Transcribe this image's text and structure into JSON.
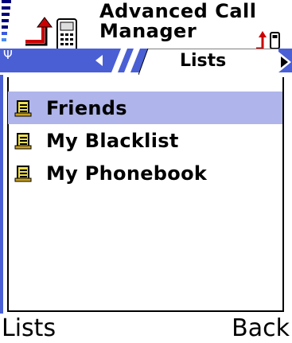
{
  "app": {
    "title_line1": "Advanced Call",
    "title_line2": "Manager"
  },
  "status": {
    "signal_icon": "signal-strength-icon",
    "antenna_glyph": "Ψ"
  },
  "tabs": {
    "active_label": "Lists",
    "prev_icon": "tab-prev-arrow-icon",
    "next_icon": "tab-next-arrow-icon"
  },
  "list": {
    "items": [
      {
        "label": "Friends",
        "icon": "scroll-list-icon",
        "selected": true
      },
      {
        "label": "My Blacklist",
        "icon": "scroll-list-icon",
        "selected": false
      },
      {
        "label": "My Phonebook",
        "icon": "scroll-list-icon",
        "selected": false
      }
    ]
  },
  "softkeys": {
    "left": "Lists",
    "right": "Back"
  },
  "colors": {
    "accent": "#4a5fd4",
    "selection": "#afb4ea",
    "arrow_red": "#cc0000",
    "signal": "#00007a"
  }
}
